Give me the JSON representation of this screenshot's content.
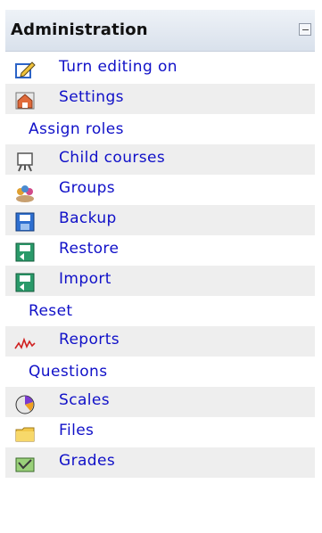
{
  "admin": {
    "title": "Administration",
    "collapse_icon": "minus-icon",
    "items": [
      {
        "label": "Turn editing on",
        "icon": "edit-pencil-icon"
      },
      {
        "label": "Settings",
        "icon": "settings-house-icon"
      },
      {
        "label": "Assign roles",
        "icon": ""
      },
      {
        "label": "Child courses",
        "icon": "easel-icon"
      },
      {
        "label": "Groups",
        "icon": "groups-icon"
      },
      {
        "label": "Backup",
        "icon": "backup-disk-icon"
      },
      {
        "label": "Restore",
        "icon": "restore-disk-icon"
      },
      {
        "label": "Import",
        "icon": "import-disk-icon"
      },
      {
        "label": "Reset",
        "icon": ""
      },
      {
        "label": "Reports",
        "icon": "reports-graph-icon"
      },
      {
        "label": "Questions",
        "icon": ""
      },
      {
        "label": "Scales",
        "icon": "scales-pie-icon"
      },
      {
        "label": "Files",
        "icon": "folder-icon"
      },
      {
        "label": "Grades",
        "icon": "grades-icon"
      }
    ]
  },
  "colors": {
    "link": "#1010c8",
    "header_bg": "#dde4ee",
    "row_alt": "#eeeeee"
  }
}
